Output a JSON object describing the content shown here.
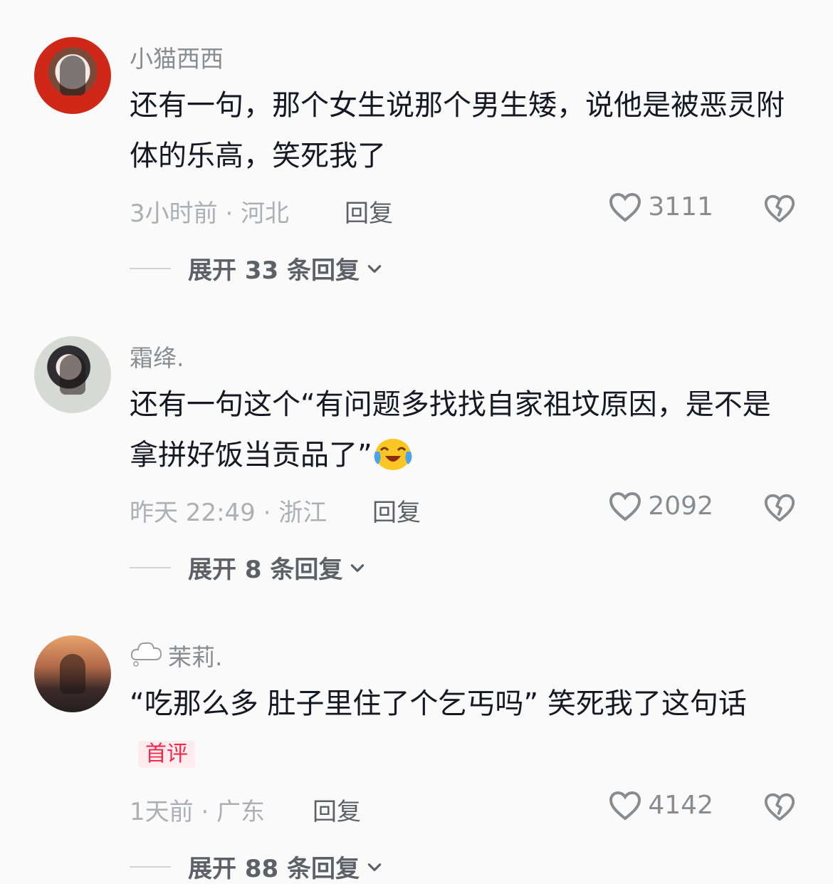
{
  "comments": [
    {
      "username": "小猫西西",
      "text": "还有一句，那个女生说那个男生矮，说他是被恶灵附体的乐高，笑死我了",
      "meta": "3小时前 · 河北",
      "reply_label": "回复",
      "likes": "3111",
      "expand_label": "展开 33 条回复"
    },
    {
      "username": "霜绛.",
      "text": "还有一句这个“有问题多找找自家祖坟原因，是不是拿拼好饭当贡品了”",
      "emoji": "crying-laughing-emoji",
      "meta": "昨天 22:49 · 浙江",
      "reply_label": "回复",
      "likes": "2092",
      "expand_label": "展开 8 条回复"
    },
    {
      "username": "茉莉.",
      "username_icon": "cloud-icon",
      "text": "“吃那么多 肚子里住了个乞丐吗” 笑死我了这句话",
      "badge": "首评",
      "meta": "1天前 · 广东",
      "reply_label": "回复",
      "likes": "4142",
      "expand_label": "展开 88 条回复"
    }
  ],
  "colors": {
    "background": "#fafafa",
    "text": "#161823",
    "secondary": "#8a8b91",
    "badge": "#f5294e"
  }
}
